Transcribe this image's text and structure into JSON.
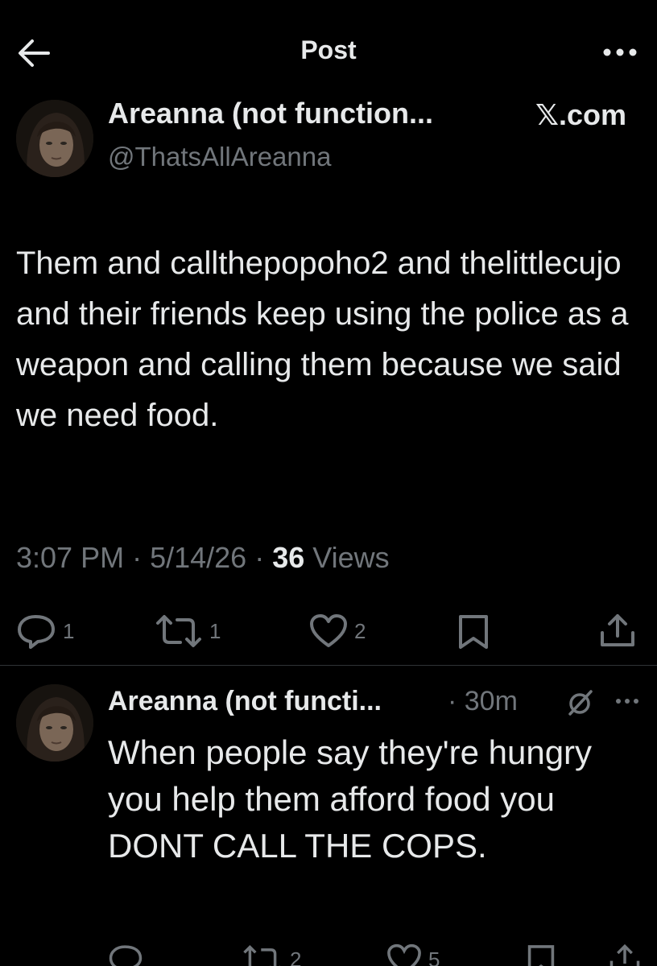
{
  "header": {
    "title": "Post",
    "back_icon": "arrow-left-icon",
    "more_icon": "more-horizontal-icon"
  },
  "post": {
    "author_name": "Areanna (not function...",
    "author_handle": "@ThatsAllAreanna",
    "source": "𝕏.com",
    "text": "Them and callthepopoho2 and thelittlecujo and their friends keep using the police as a weapon and calling them because we said we need food.",
    "time": "3:07 PM",
    "date": "5/14/26",
    "separator": " · ",
    "views_count": "36",
    "views_label": "Views",
    "actions": {
      "replies": "1",
      "reposts": "1",
      "likes": "2"
    }
  },
  "reply": {
    "author_name": "Areanna (not functi...",
    "time_ago": "· 30m",
    "text": "When people say they're hungry you help them afford food you DONT CALL THE COPS.",
    "actions": {
      "reposts": "2",
      "likes": "5"
    }
  },
  "colors": {
    "background": "#000000",
    "text_primary": "#e7e9ea",
    "text_secondary": "#71767b",
    "divider": "#2f3336"
  }
}
